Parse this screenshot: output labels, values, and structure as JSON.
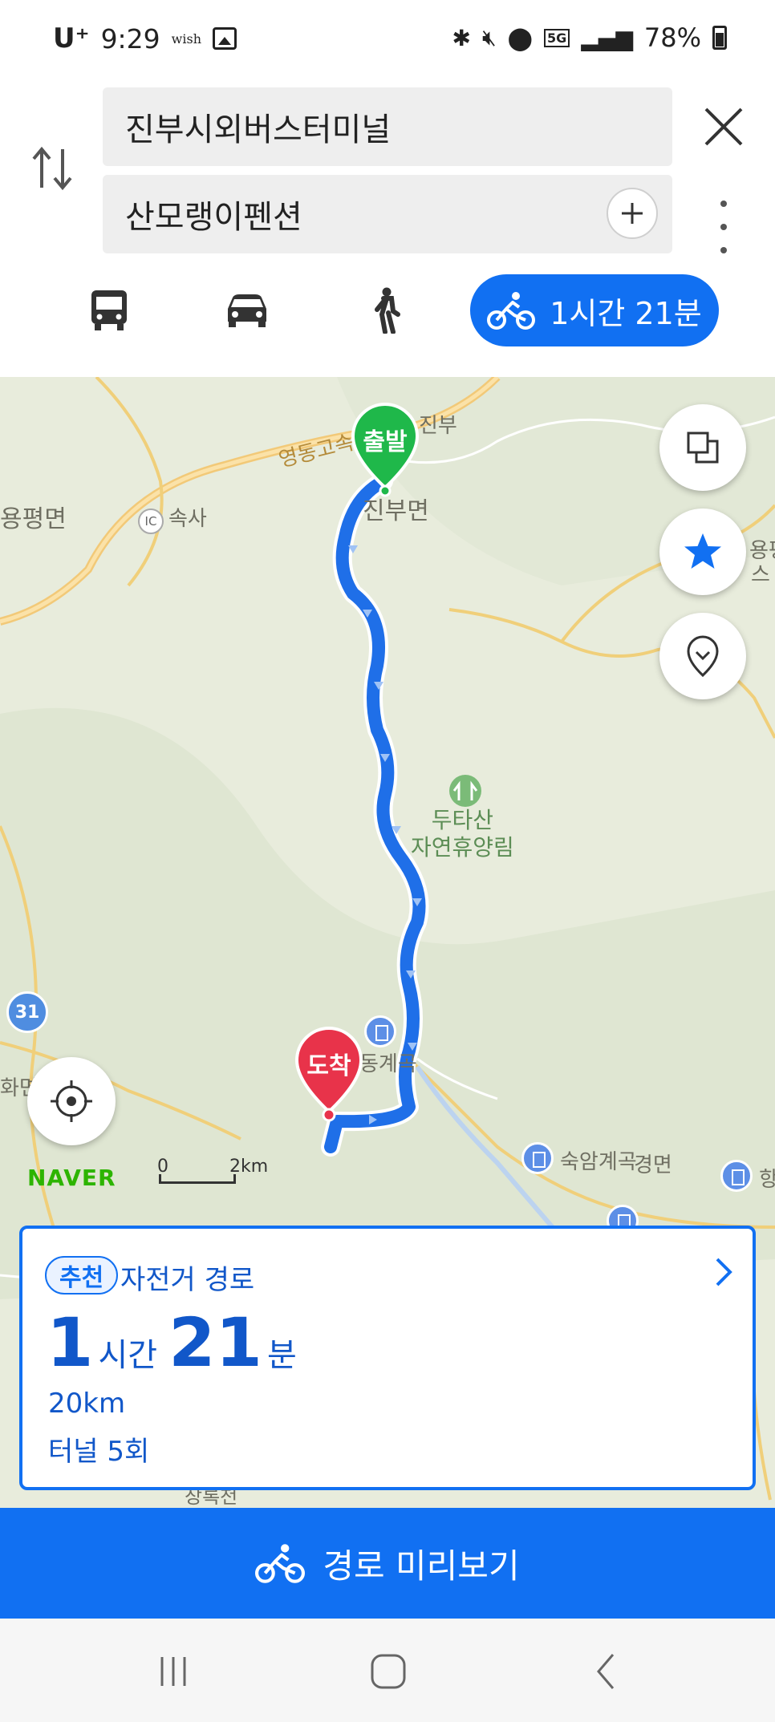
{
  "status_bar": {
    "carrier": "U⁺",
    "time": "9:29",
    "wish": "wish",
    "network": "5G",
    "battery": "78%"
  },
  "search": {
    "start": "진부시외버스터미널",
    "destination": "산모랭이펜션"
  },
  "modes": {
    "selected_duration": "1시간 21분"
  },
  "map": {
    "labels": {
      "highway": "영동고속",
      "jinbu": "진부",
      "jinbu_myeon": "진부면",
      "yongpyeong": "용평면",
      "ic": "IC",
      "sogsa": "속사",
      "dutasan_line1": "두타산",
      "dutasan_line2": "자연휴양림",
      "valley_partial": "동계곡",
      "sukam": "숙암계곡",
      "myeon_partial": "경면",
      "hwa_partial": "화면",
      "right_partial1": "용평",
      "right_partial2": "스",
      "bottom_partial": "장록천",
      "right_edge_partial": "항"
    },
    "route_number": "31",
    "start_pin": "출발",
    "end_pin": "도착",
    "logo": "NAVER",
    "scale_start": "0",
    "scale_end": "2km"
  },
  "summary": {
    "badge": "추천",
    "route_type": "자전거 경로",
    "hours": "1",
    "hours_unit": "시간",
    "minutes": "21",
    "minutes_unit": "분",
    "distance": "20km",
    "tunnels": "터널 5회"
  },
  "preview_button": "경로 미리보기",
  "colors": {
    "accent": "#1170f2",
    "start_pin": "#1fb84a",
    "end_pin": "#e8334a",
    "route": "#1f6fe8"
  }
}
